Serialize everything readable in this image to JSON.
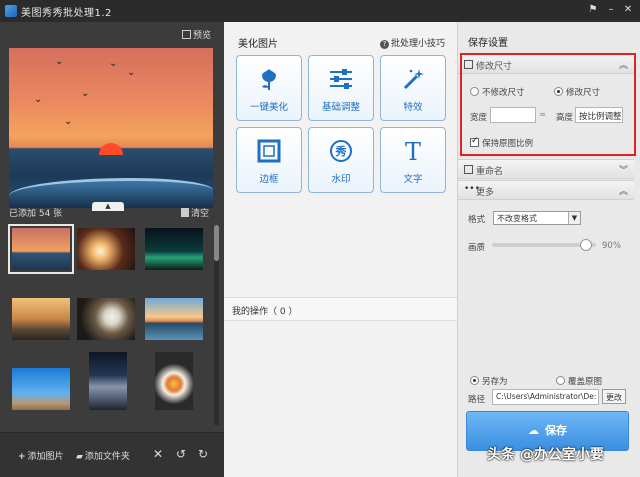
{
  "window": {
    "title": "美图秀秀批处理1.2"
  },
  "left_panel": {
    "preview_label": "预览",
    "added_count_label": "已添加 54 张",
    "clear_label": "清空",
    "add_image_label": "添加图片",
    "add_folder_label": "添加文件夹"
  },
  "center_panel": {
    "title": "美化图片",
    "tips_label": "批处理小技巧",
    "tools": [
      {
        "label": "一键美化",
        "icon": "tulip-icon"
      },
      {
        "label": "基础调整",
        "icon": "sliders-icon"
      },
      {
        "label": "特效",
        "icon": "magic-wand-icon"
      },
      {
        "label": "边框",
        "icon": "frame-icon"
      },
      {
        "label": "水印",
        "icon": "xiu-badge-icon"
      },
      {
        "label": "文字",
        "icon": "text-t-icon"
      }
    ],
    "ops_label": "我的操作（ 0 ）"
  },
  "right_panel": {
    "title": "保存设置",
    "resize": {
      "header": "修改尺寸",
      "option_keep": "不修改尺寸",
      "option_change": "修改尺寸",
      "selected": "修改尺寸",
      "width_label": "宽度",
      "width_value": "",
      "height_label": "高度",
      "height_value": "按比例调整",
      "keep_ratio_label": "保持原图比例",
      "keep_ratio_checked": true
    },
    "rename_header": "重命名",
    "more_header": "更多",
    "format_label": "格式",
    "format_value": "不改变格式",
    "quality_label": "画质",
    "quality_value": "90%",
    "quality_level": 0.9,
    "save_as_label": "另存为",
    "overwrite_label": "覆盖原图",
    "path_label": "路径",
    "path_value": "C:\\Users\\Administrator\\De:",
    "change_button": "更改",
    "save_button": "保存"
  },
  "watermark": {
    "text": "头条 @办公室小要"
  }
}
